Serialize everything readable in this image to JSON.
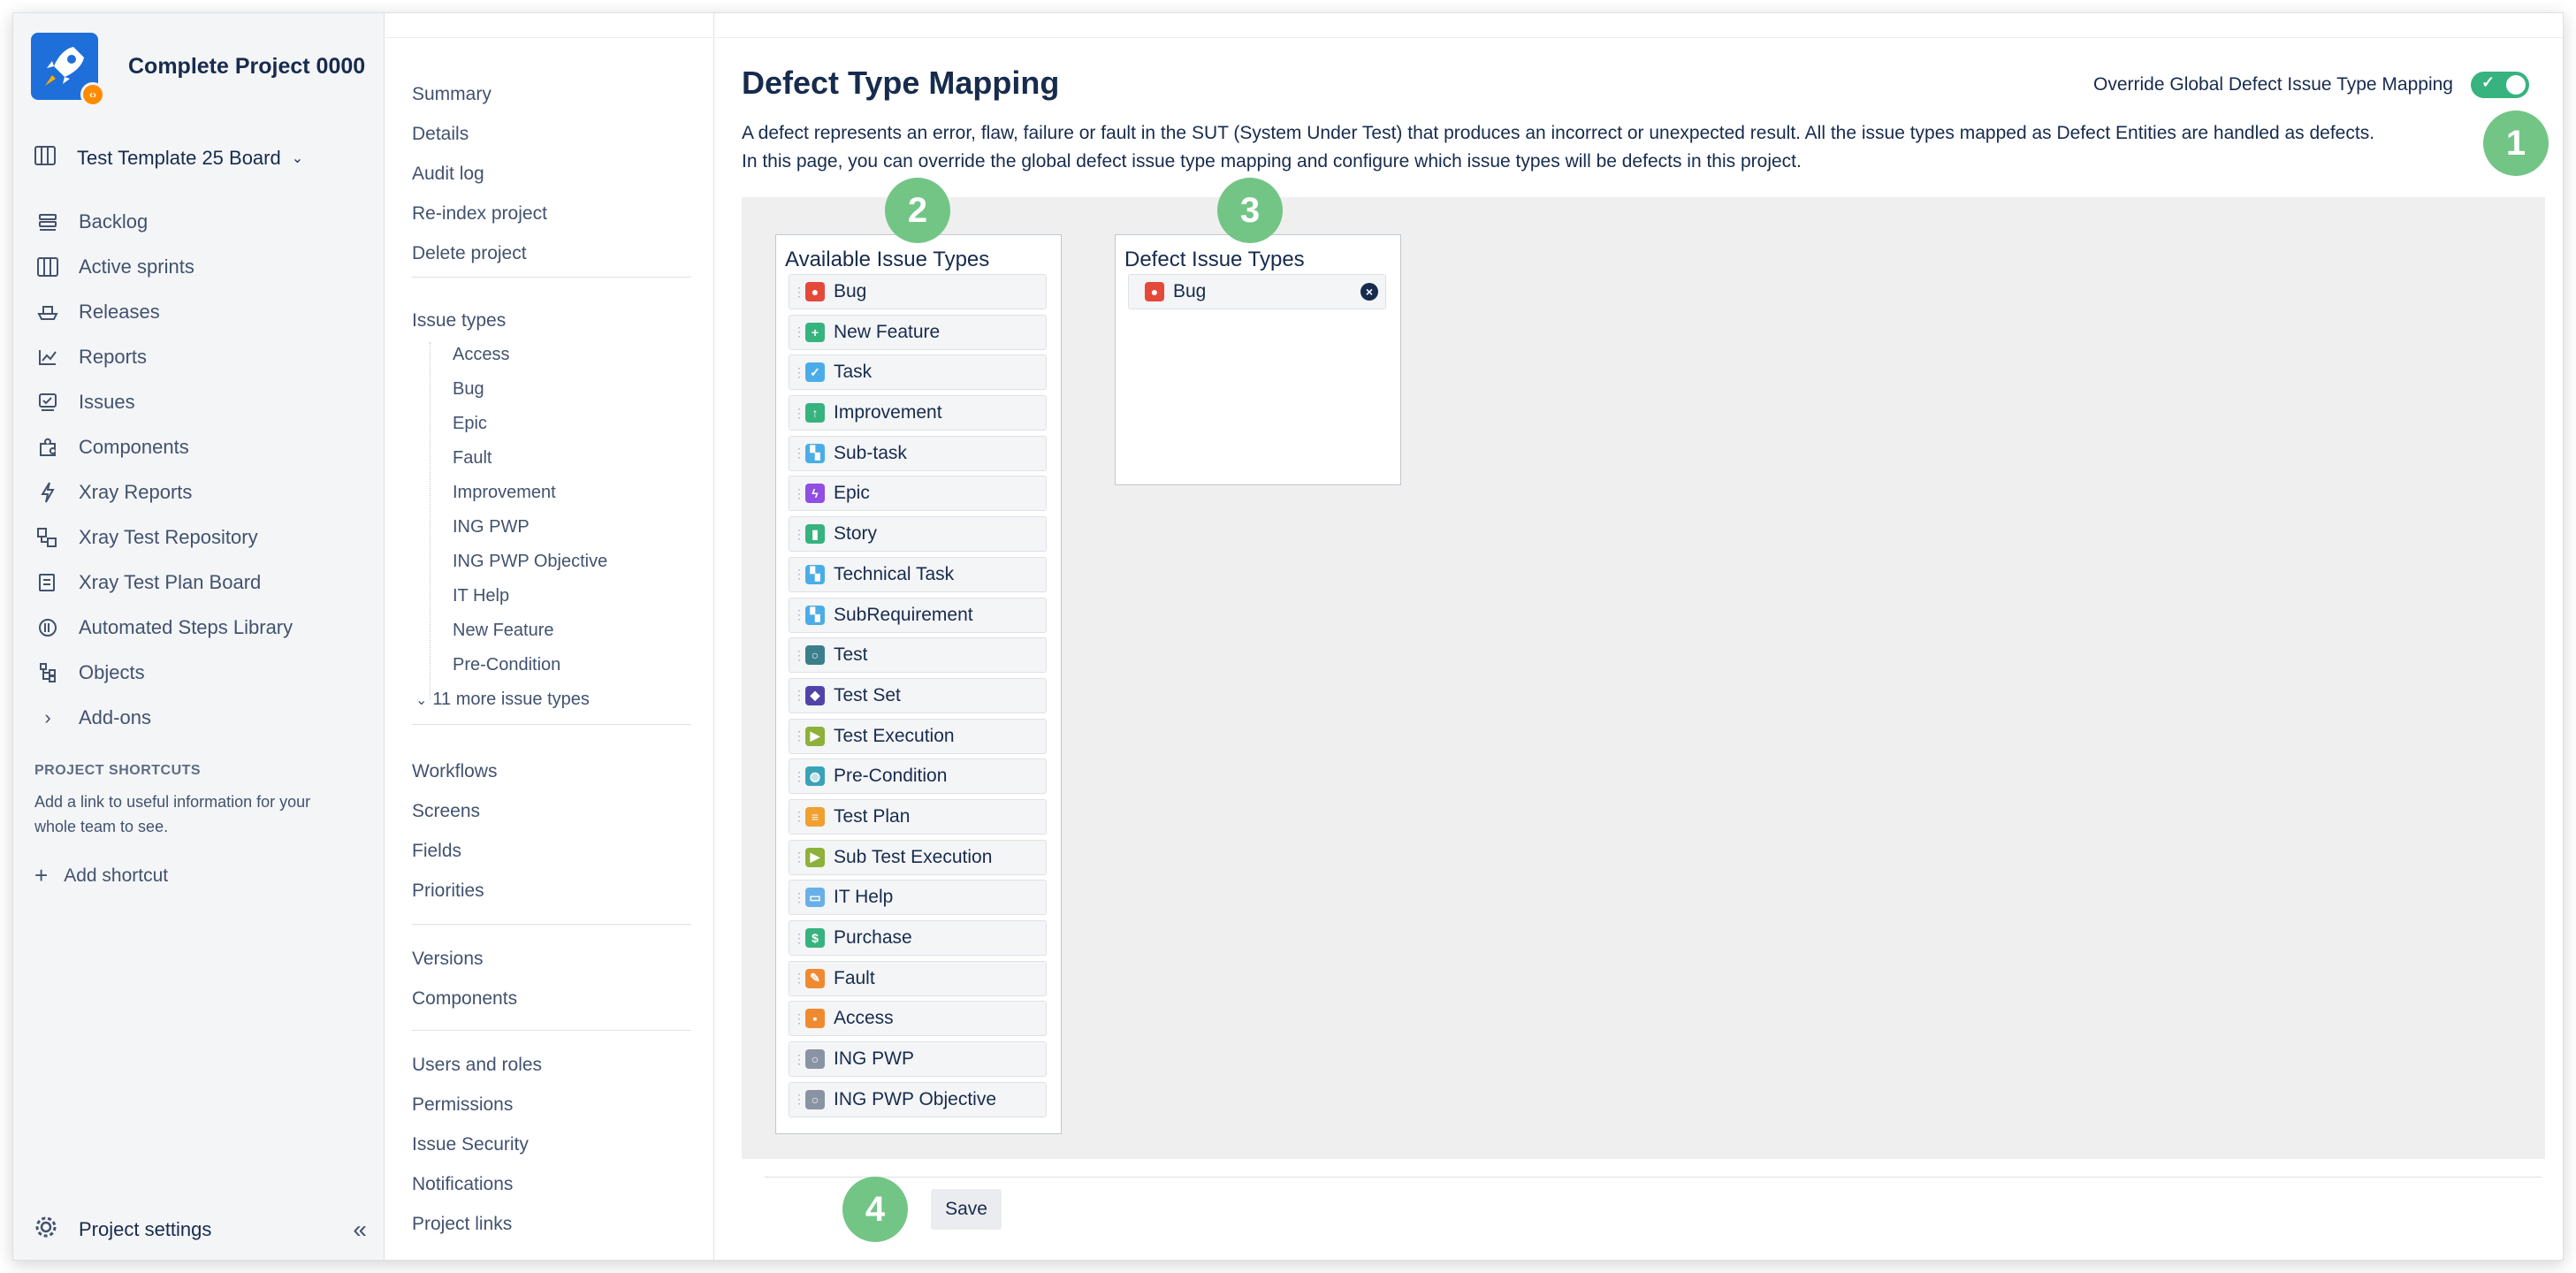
{
  "sidebar": {
    "project_name": "Complete Project 0000",
    "board_label": "Test Template 25 Board",
    "items": [
      {
        "label": "Backlog",
        "icon": "backlog-icon"
      },
      {
        "label": "Active sprints",
        "icon": "board-icon"
      },
      {
        "label": "Releases",
        "icon": "ship-icon"
      },
      {
        "label": "Reports",
        "icon": "chart-icon"
      },
      {
        "label": "Issues",
        "icon": "issues-icon"
      },
      {
        "label": "Components",
        "icon": "puzzle-icon"
      },
      {
        "label": "Xray Reports",
        "icon": "lightning-icon"
      },
      {
        "label": "Xray Test Repository",
        "icon": "repository-icon"
      },
      {
        "label": "Xray Test Plan Board",
        "icon": "plan-board-icon"
      },
      {
        "label": "Automated Steps Library",
        "icon": "library-icon"
      },
      {
        "label": "Objects",
        "icon": "objects-icon"
      },
      {
        "label": "Add-ons",
        "icon": "chevron-right-icon"
      }
    ],
    "shortcuts_heading": "PROJECT SHORTCUTS",
    "shortcuts_text": "Add a link to useful information for your whole team to see.",
    "add_shortcut": "Add shortcut",
    "footer": "Project settings"
  },
  "settings_nav": {
    "group1": [
      "Summary",
      "Details",
      "Audit log",
      "Re-index project",
      "Delete project"
    ],
    "issue_types_label": "Issue types",
    "issue_types": [
      "Access",
      "Bug",
      "Epic",
      "Fault",
      "Improvement",
      "ING PWP",
      "ING PWP Objective",
      "IT Help",
      "New Feature",
      "Pre-Condition"
    ],
    "more_issue_types": "11 more issue types",
    "group2": [
      "Workflows",
      "Screens",
      "Fields",
      "Priorities"
    ],
    "group3": [
      "Versions",
      "Components"
    ],
    "group4": [
      "Users and roles",
      "Permissions",
      "Issue Security",
      "Notifications",
      "Project links"
    ]
  },
  "main": {
    "title": "Defect Type Mapping",
    "override_label": "Override Global Defect Issue Type Mapping",
    "override_enabled": true,
    "description_1": "A defect represents an error, flaw, failure or fault in the SUT (System Under Test) that produces an incorrect or unexpected result. All the issue types mapped as Defect Entities are handled as defects.",
    "description_2": "In this page, you can override the global defect issue type mapping and configure which issue types will be defects in this project.",
    "available_title": "Available Issue Types",
    "available": [
      {
        "label": "Bug",
        "color": "#e5493a",
        "glyph": "●"
      },
      {
        "label": "New Feature",
        "color": "#36b37e",
        "glyph": "+"
      },
      {
        "label": "Task",
        "color": "#4bade8",
        "glyph": "✓"
      },
      {
        "label": "Improvement",
        "color": "#36b37e",
        "glyph": "↑"
      },
      {
        "label": "Sub-task",
        "color": "#4bade8",
        "glyph": "▚"
      },
      {
        "label": "Epic",
        "color": "#904ee2",
        "glyph": "ϟ"
      },
      {
        "label": "Story",
        "color": "#36b37e",
        "glyph": "▮"
      },
      {
        "label": "Technical Task",
        "color": "#4bade8",
        "glyph": "▚"
      },
      {
        "label": "SubRequirement",
        "color": "#4bade8",
        "glyph": "▚"
      },
      {
        "label": "Test",
        "color": "#3b7f8c",
        "glyph": "○"
      },
      {
        "label": "Test Set",
        "color": "#5243aa",
        "glyph": "◆"
      },
      {
        "label": "Test Execution",
        "color": "#8db13a",
        "glyph": "▶"
      },
      {
        "label": "Pre-Condition",
        "color": "#3aa3b8",
        "glyph": "◍"
      },
      {
        "label": "Test Plan",
        "color": "#f0a030",
        "glyph": "≡"
      },
      {
        "label": "Sub Test Execution",
        "color": "#8db13a",
        "glyph": "▶"
      },
      {
        "label": "IT Help",
        "color": "#6ab0e8",
        "glyph": "▭"
      },
      {
        "label": "Purchase",
        "color": "#36b37e",
        "glyph": "$"
      },
      {
        "label": "Fault",
        "color": "#f08a30",
        "glyph": "✎"
      },
      {
        "label": "Access",
        "color": "#f08a30",
        "glyph": "▪"
      },
      {
        "label": "ING PWP",
        "color": "#8993a4",
        "glyph": "○"
      },
      {
        "label": "ING PWP Objective",
        "color": "#8993a4",
        "glyph": "○"
      }
    ],
    "defect_title": "Defect Issue Types",
    "defect": [
      {
        "label": "Bug",
        "color": "#e5493a",
        "glyph": "●"
      }
    ],
    "save_label": "Save",
    "markers": [
      "1",
      "2",
      "3",
      "4"
    ]
  },
  "colors": {
    "accent": "#0052cc",
    "toggle_on": "#36b37e",
    "marker": "#73c586"
  }
}
